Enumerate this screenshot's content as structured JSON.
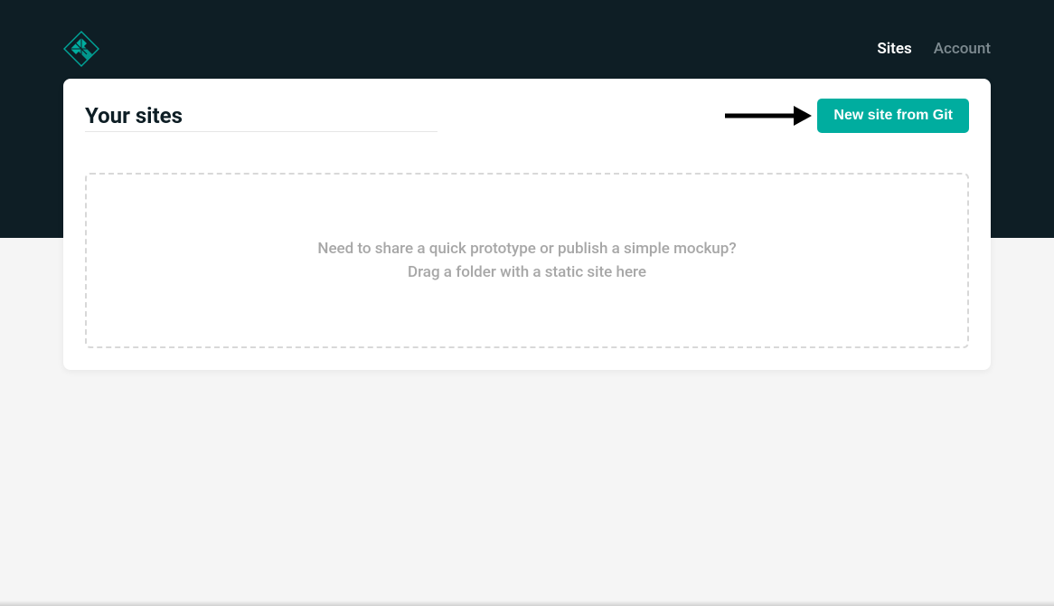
{
  "nav": {
    "sites": "Sites",
    "account": "Account"
  },
  "page": {
    "title": "Your sites",
    "new_site_button": "New site from Git"
  },
  "dropzone": {
    "line1": "Need to share a quick prototype or publish a simple mockup?",
    "line2": "Drag a folder with a static site here"
  },
  "colors": {
    "header_bg": "#0e1e25",
    "accent": "#00ad9f"
  }
}
